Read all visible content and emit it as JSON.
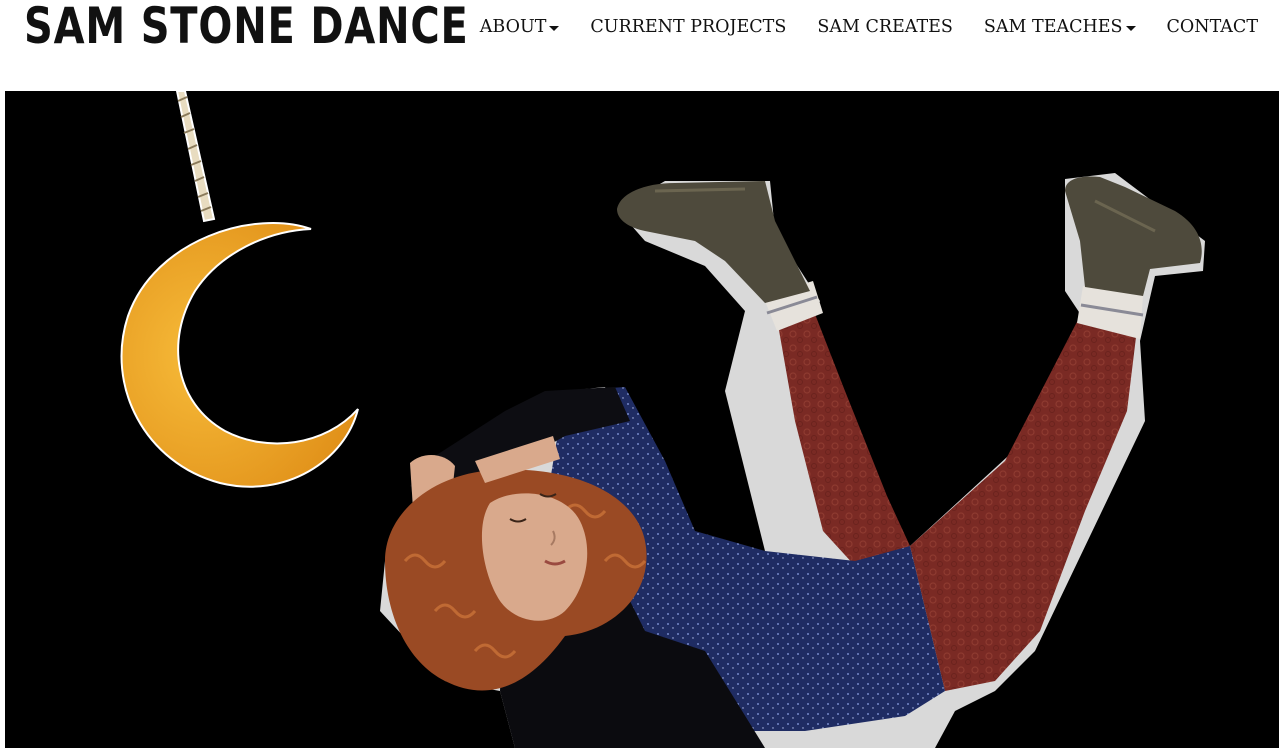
{
  "site": {
    "logo_text": "SAM STONE DANCE"
  },
  "nav": {
    "items": [
      {
        "label": "ABOUT",
        "dropdown": true
      },
      {
        "label": "CURRENT PROJECTS",
        "dropdown": false
      },
      {
        "label": "SAM CREATES",
        "dropdown": false
      },
      {
        "label": "SAM TEACHES",
        "dropdown": true
      },
      {
        "label": "CONTACT",
        "dropdown": false
      }
    ]
  },
  "hero": {
    "icon": "hero-illustration",
    "colors": {
      "background": "#000000",
      "moon": "#f2a623",
      "rope": "#e8dcc0",
      "sweater": "#1d2a5e",
      "pants": "#7a2a24",
      "boots": "#4e4a3c",
      "hair": "#9a4a24",
      "skin": "#d9a98c"
    }
  }
}
